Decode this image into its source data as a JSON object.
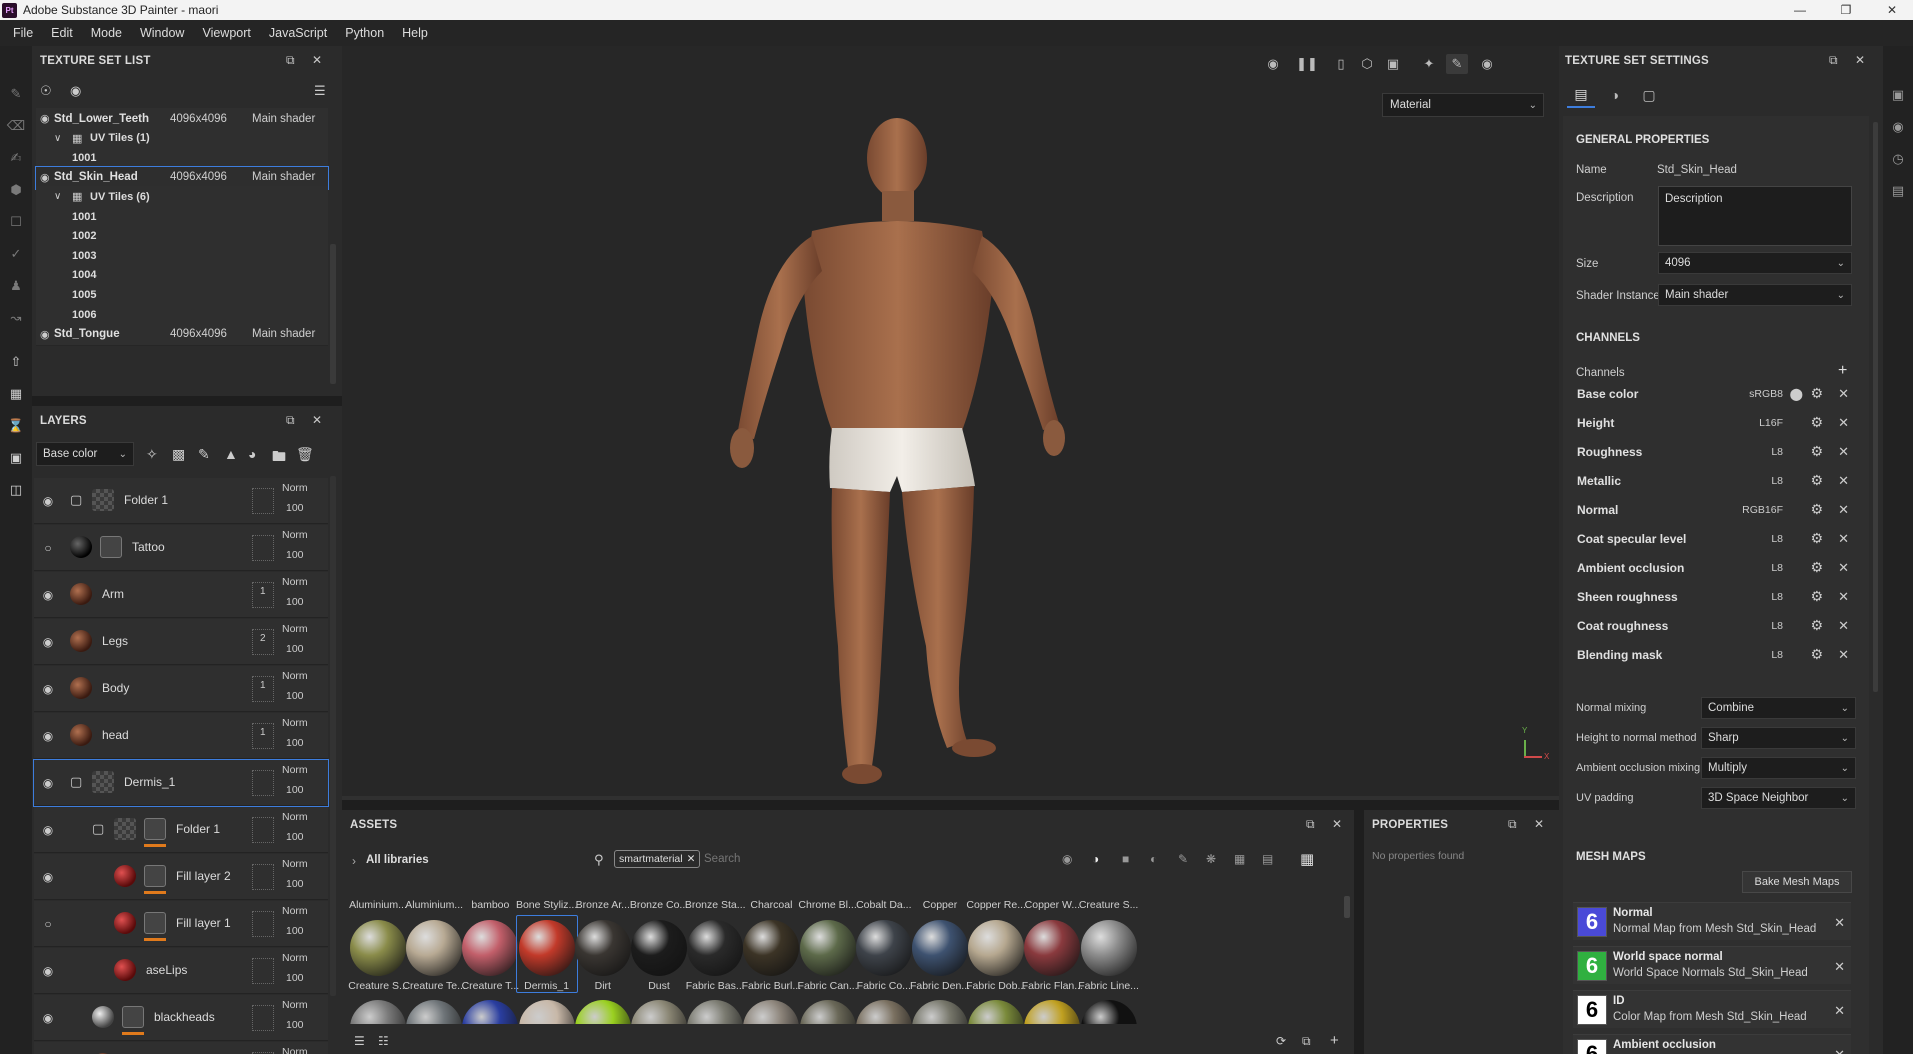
{
  "window": {
    "title": "Adobe Substance 3D Painter - maori",
    "logo": "Pt"
  },
  "menu": [
    "File",
    "Edit",
    "Mode",
    "Window",
    "Viewport",
    "JavaScript",
    "Python",
    "Help"
  ],
  "texture_set_list": {
    "title": "TEXTURE SET LIST",
    "rows": [
      {
        "type": "set",
        "name": "Std_Lower_Teeth",
        "res": "4096x4096",
        "shader": "Main shader"
      },
      {
        "type": "uvgroup",
        "name": "UV Tiles (1)"
      },
      {
        "type": "tile",
        "name": "1001"
      },
      {
        "type": "set",
        "name": "Std_Skin_Head",
        "res": "4096x4096",
        "shader": "Main shader",
        "selected": true
      },
      {
        "type": "uvgroup",
        "name": "UV Tiles (6)"
      },
      {
        "type": "tile",
        "name": "1001"
      },
      {
        "type": "tile",
        "name": "1002"
      },
      {
        "type": "tile",
        "name": "1003"
      },
      {
        "type": "tile",
        "name": "1004"
      },
      {
        "type": "tile",
        "name": "1005"
      },
      {
        "type": "tile",
        "name": "1006"
      },
      {
        "type": "set",
        "name": "Std_Tongue",
        "res": "4096x4096",
        "shader": "Main shader"
      }
    ]
  },
  "layers": {
    "title": "LAYERS",
    "channel_select": "Base color",
    "rows": [
      {
        "name": "Folder 1",
        "kind": "folder",
        "indent": 0,
        "blend": "Norm",
        "opacity": "100",
        "visible": true
      },
      {
        "name": "Tattoo",
        "kind": "fill-mask",
        "indent": 0,
        "blend": "Norm",
        "opacity": "100",
        "visible": false
      },
      {
        "name": "Arm",
        "kind": "paint",
        "indent": 0,
        "blend": "Norm",
        "opacity": "100",
        "visible": true,
        "count": "1"
      },
      {
        "name": "Legs",
        "kind": "paint",
        "indent": 0,
        "blend": "Norm",
        "opacity": "100",
        "visible": true,
        "count": "2"
      },
      {
        "name": "Body",
        "kind": "paint",
        "indent": 0,
        "blend": "Norm",
        "opacity": "100",
        "visible": true,
        "count": "1"
      },
      {
        "name": "head",
        "kind": "paint",
        "indent": 0,
        "blend": "Norm",
        "opacity": "100",
        "visible": true,
        "count": "1"
      },
      {
        "name": "Dermis_1",
        "kind": "folder",
        "indent": 0,
        "blend": "Norm",
        "opacity": "100",
        "visible": true,
        "selected": true
      },
      {
        "name": "Folder 1",
        "kind": "folder-mask",
        "indent": 1,
        "blend": "Norm",
        "opacity": "100",
        "visible": true
      },
      {
        "name": "Fill layer 2",
        "kind": "fill-red-mask",
        "indent": 2,
        "blend": "Norm",
        "opacity": "100",
        "visible": true
      },
      {
        "name": "Fill layer 1",
        "kind": "fill-red-mask",
        "indent": 2,
        "blend": "Norm",
        "opacity": "100",
        "visible": false
      },
      {
        "name": "aseLips",
        "kind": "fill-red",
        "indent": 2,
        "blend": "Norm",
        "opacity": "100",
        "visible": true
      },
      {
        "name": "blackheads",
        "kind": "grey-mask",
        "indent": 1,
        "blend": "Norm",
        "opacity": "100",
        "visible": true
      },
      {
        "name": "",
        "kind": "paint",
        "indent": 1,
        "blend": "Norm",
        "opacity": "",
        "visible": true
      }
    ]
  },
  "viewport": {
    "material_mode": "Material",
    "axis_y": "Y",
    "axis_x": "X"
  },
  "assets": {
    "title": "ASSETS",
    "library": "All libraries",
    "filter_tag": "smartmaterial",
    "search_placeholder": "Search",
    "top_row": [
      "Aluminium...",
      "Aluminium...",
      "bamboo",
      "Bone Styliz...",
      "Bronze Ar...",
      "Bronze Co...",
      "Bronze Sta...",
      "Charcoal",
      "Chrome Bl...",
      "Cobalt Da...",
      "Copper",
      "Copper Re...",
      "Copper W...",
      "Creature S..."
    ],
    "mid_row": [
      {
        "name": "Creature S...",
        "color": "#8a8c4a"
      },
      {
        "name": "Creature Te...",
        "color": "#b8aa94"
      },
      {
        "name": "Creature T...",
        "color": "#c25f6a"
      },
      {
        "name": "Dermis_1",
        "color": "#c23a2a",
        "selected": true
      },
      {
        "name": "Dirt",
        "color": "#3a3632"
      },
      {
        "name": "Dust",
        "color": "#1c1c1c"
      },
      {
        "name": "Fabric Bas...",
        "color": "#2a2a2a"
      },
      {
        "name": "Fabric Burl...",
        "color": "#3c3426"
      },
      {
        "name": "Fabric Can...",
        "color": "#5d6a4a"
      },
      {
        "name": "Fabric Co...",
        "color": "#3e434a"
      },
      {
        "name": "Fabric Den...",
        "color": "#3e5270"
      },
      {
        "name": "Fabric Dob...",
        "color": "#b6a890"
      },
      {
        "name": "Fabric Flan...",
        "color": "#8a3a3e"
      },
      {
        "name": "Fabric Line...",
        "color": "#8c8c8c"
      }
    ],
    "bottom_colors": [
      "#7a7a7a",
      "#6e7478",
      "#2a3ea0",
      "#c8b8a8",
      "#9ad020",
      "#8a8674",
      "#7a7a70",
      "#8c847a",
      "#6a6858",
      "#7a7060",
      "#76766a",
      "#7a8a3a",
      "#c0a020",
      "#111111"
    ]
  },
  "properties": {
    "title": "PROPERTIES",
    "empty": "No properties found"
  },
  "texture_set_settings": {
    "title": "TEXTURE SET SETTINGS",
    "general_title": "GENERAL PROPERTIES",
    "name_label": "Name",
    "name_value": "Std_Skin_Head",
    "desc_label": "Description",
    "desc_value": "Description",
    "size_label": "Size",
    "size_value": "4096",
    "shader_label": "Shader Instance",
    "shader_value": "Main shader",
    "channels_title": "CHANNELS",
    "channels_label": "Channels",
    "channels": [
      {
        "name": "Base color",
        "format": "sRGB8"
      },
      {
        "name": "Height",
        "format": "L16F"
      },
      {
        "name": "Roughness",
        "format": "L8"
      },
      {
        "name": "Metallic",
        "format": "L8"
      },
      {
        "name": "Normal",
        "format": "RGB16F"
      },
      {
        "name": "Coat specular level",
        "format": "L8"
      },
      {
        "name": "Ambient occlusion",
        "format": "L8"
      },
      {
        "name": "Sheen roughness",
        "format": "L8"
      },
      {
        "name": "Coat roughness",
        "format": "L8"
      },
      {
        "name": "Blending mask",
        "format": "L8"
      }
    ],
    "options": [
      {
        "label": "Normal mixing",
        "value": "Combine"
      },
      {
        "label": "Height to normal method",
        "value": "Sharp"
      },
      {
        "label": "Ambient occlusion mixing",
        "value": "Multiply"
      },
      {
        "label": "UV padding",
        "value": "3D Space Neighbor"
      }
    ],
    "mesh_title": "MESH MAPS",
    "bake_button": "Bake Mesh Maps",
    "mesh_maps": [
      {
        "icon": "6",
        "title": "Normal",
        "desc": "Normal Map from Mesh Std_Skin_Head",
        "bg": "#4a4ad8"
      },
      {
        "icon": "6",
        "title": "World space normal",
        "desc": "World Space Normals Std_Skin_Head",
        "bg": "#30b040"
      },
      {
        "icon": "6",
        "title": "ID",
        "desc": "Color Map from Mesh Std_Skin_Head",
        "bg": "#ffffff"
      },
      {
        "icon": "6",
        "title": "Ambient occlusion",
        "desc": "",
        "bg": "#ffffff"
      }
    ]
  }
}
